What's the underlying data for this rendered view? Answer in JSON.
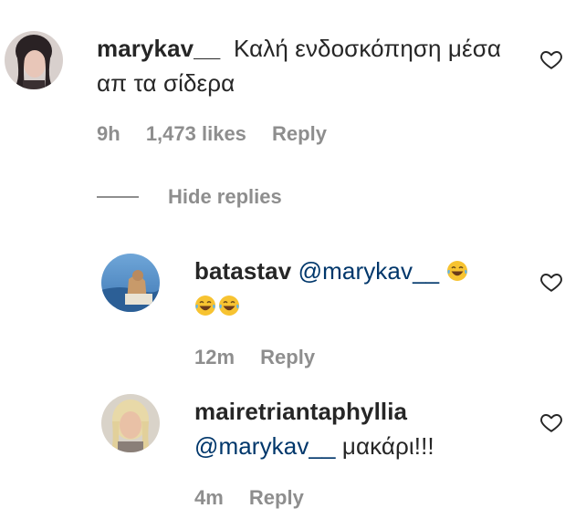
{
  "comments": [
    {
      "username": "marykav__",
      "text": "Καλή ενδοσκόπηση μέσα απ τα σίδερα",
      "time": "9h",
      "likes": "1,473 likes",
      "reply_label": "Reply"
    }
  ],
  "hide_replies_label": "Hide replies",
  "replies": [
    {
      "username": "batastav",
      "mention": "@marykav__",
      "emoji": "face-with-tears-of-joy",
      "time": "12m",
      "reply_label": "Reply"
    },
    {
      "username": "mairetriantaphyllia",
      "mention": "@marykav__",
      "text": "μακάρι!!!",
      "time": "4m",
      "reply_label": "Reply"
    }
  ],
  "colors": {
    "text": "#262626",
    "meta": "#8e8e8e",
    "mention": "#00376b",
    "emoji": "#f7c331"
  }
}
